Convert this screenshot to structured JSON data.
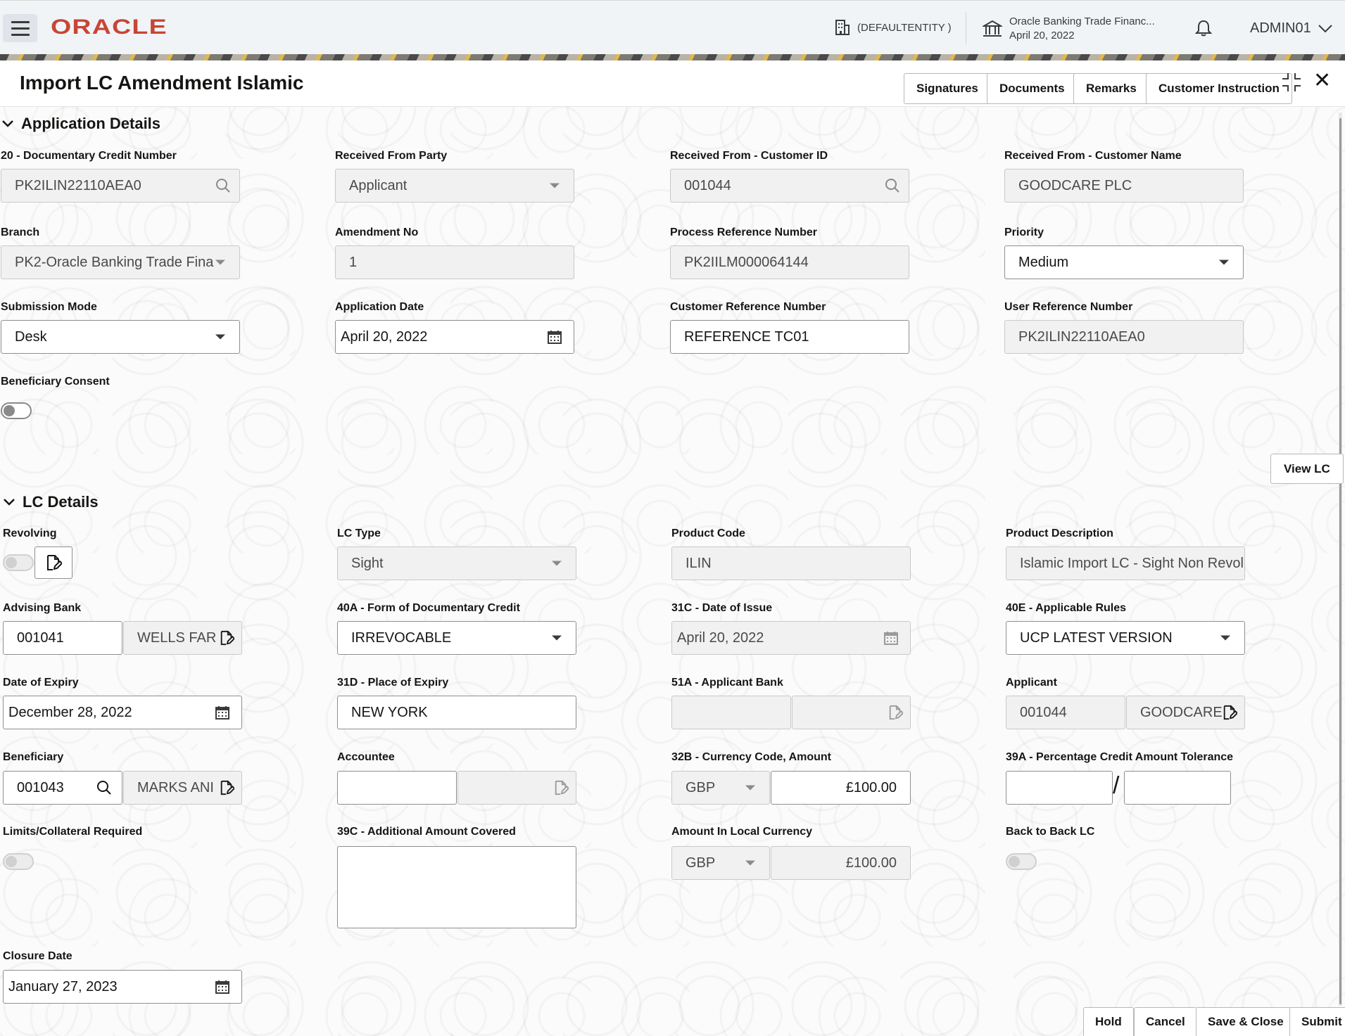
{
  "topbar": {
    "logo": "ORACLE",
    "entity": "(DEFAULTENTITY )",
    "bank_name": "Oracle Banking Trade Financ...",
    "bank_date": "April 20, 2022",
    "user": "ADMIN01"
  },
  "header": {
    "title": "Import LC Amendment Islamic",
    "buttons": {
      "signatures": "Signatures",
      "documents": "Documents",
      "remarks": "Remarks",
      "customer_instruction": "Customer Instruction"
    }
  },
  "application_details": {
    "title": "Application Details",
    "documentary_credit_number": {
      "label": "20 - Documentary Credit Number",
      "value": "PK2ILIN22110AEA0"
    },
    "received_from_party": {
      "label": "Received From Party",
      "value": "Applicant"
    },
    "received_from_customer_id": {
      "label": "Received From - Customer ID",
      "value": "001044"
    },
    "received_from_customer_name": {
      "label": "Received From - Customer Name",
      "value": "GOODCARE PLC"
    },
    "branch": {
      "label": "Branch",
      "value": "PK2-Oracle Banking Trade Fina"
    },
    "amendment_no": {
      "label": "Amendment No",
      "value": "1"
    },
    "process_reference_number": {
      "label": "Process Reference Number",
      "value": "PK2IILM000064144"
    },
    "priority": {
      "label": "Priority",
      "value": "Medium"
    },
    "submission_mode": {
      "label": "Submission Mode",
      "value": "Desk"
    },
    "application_date": {
      "label": "Application Date",
      "value": "April 20, 2022"
    },
    "customer_reference_number": {
      "label": "Customer Reference Number",
      "value": "REFERENCE TC01"
    },
    "user_reference_number": {
      "label": "User Reference Number",
      "value": "PK2ILIN22110AEA0"
    },
    "beneficiary_consent": {
      "label": "Beneficiary Consent",
      "on": false
    },
    "view_lc": "View LC"
  },
  "lc_details": {
    "title": "LC Details",
    "revolving": {
      "label": "Revolving",
      "on": false
    },
    "lc_type": {
      "label": "LC Type",
      "value": "Sight"
    },
    "product_code": {
      "label": "Product Code",
      "value": "ILIN"
    },
    "product_description": {
      "label": "Product Description",
      "value": "Islamic Import LC - Sight Non Revol"
    },
    "advising_bank": {
      "label": "Advising Bank",
      "id": "001041",
      "name": "WELLS FAR"
    },
    "form_of_credit": {
      "label": "40A - Form of Documentary Credit",
      "value": "IRREVOCABLE"
    },
    "date_of_issue": {
      "label": "31C - Date of Issue",
      "value": "April 20, 2022"
    },
    "applicable_rules": {
      "label": "40E - Applicable Rules",
      "value": "UCP LATEST VERSION"
    },
    "date_of_expiry": {
      "label": "Date of Expiry",
      "value": "December 28, 2022"
    },
    "place_of_expiry": {
      "label": "31D - Place of Expiry",
      "value": "NEW YORK"
    },
    "applicant_bank": {
      "label": "51A - Applicant Bank",
      "id": "",
      "name": ""
    },
    "applicant": {
      "label": "Applicant",
      "id": "001044",
      "name": "GOODCARE"
    },
    "beneficiary": {
      "label": "Beneficiary",
      "id": "001043",
      "name": "MARKS ANI"
    },
    "accountee": {
      "label": "Accountee",
      "id": "",
      "name": ""
    },
    "currency_amount": {
      "label": "32B - Currency Code, Amount",
      "currency": "GBP",
      "amount": "£100.00"
    },
    "tolerance": {
      "label": "39A - Percentage Credit Amount Tolerance",
      "plus": "",
      "minus": "",
      "separator": "/"
    },
    "limits_collateral": {
      "label": "Limits/Collateral Required",
      "on": false
    },
    "additional_amount": {
      "label": "39C - Additional Amount Covered",
      "value": ""
    },
    "amount_local": {
      "label": "Amount In Local Currency",
      "currency": "GBP",
      "amount": "£100.00"
    },
    "back_to_back": {
      "label": "Back to Back LC",
      "on": false
    },
    "closure_date": {
      "label": "Closure Date",
      "value": "January 27, 2023"
    }
  },
  "footer": {
    "hold": "Hold",
    "cancel": "Cancel",
    "save_close": "Save & Close",
    "submit": "Submit"
  },
  "colors": {
    "brand": "#c74634",
    "topbar": "#f1f4f7",
    "disabled_field": "#f1f1f1"
  }
}
